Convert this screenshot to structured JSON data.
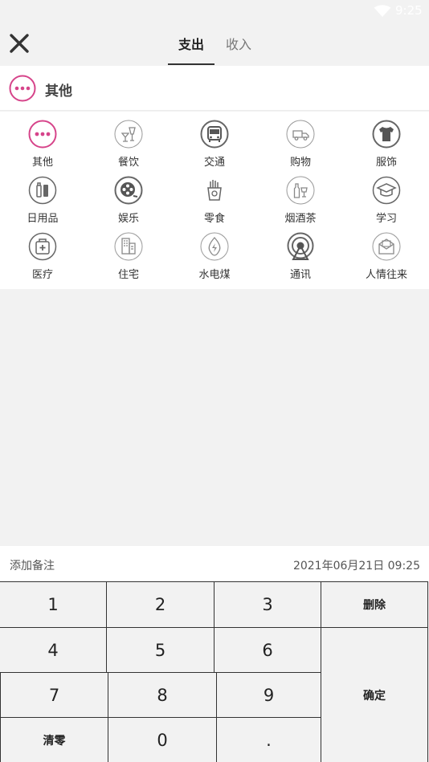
{
  "status_bar": {
    "time": "9:25"
  },
  "tabs": [
    {
      "label": "支出",
      "active": true
    },
    {
      "label": "收入",
      "active": false
    }
  ],
  "selected_category": {
    "label": "其他",
    "icon": "more-dots-icon",
    "accent_color": "#d6448a"
  },
  "categories": [
    {
      "label": "其他",
      "icon": "more-dots-icon"
    },
    {
      "label": "餐饮",
      "icon": "dining-icon"
    },
    {
      "label": "交通",
      "icon": "bus-icon"
    },
    {
      "label": "购物",
      "icon": "truck-icon"
    },
    {
      "label": "服饰",
      "icon": "tshirt-icon"
    },
    {
      "label": "日用品",
      "icon": "toiletries-icon"
    },
    {
      "label": "娱乐",
      "icon": "film-reel-icon"
    },
    {
      "label": "零食",
      "icon": "snack-icon"
    },
    {
      "label": "烟酒茶",
      "icon": "bottle-cup-icon"
    },
    {
      "label": "学习",
      "icon": "graduation-cap-icon"
    },
    {
      "label": "医疗",
      "icon": "medical-kit-icon"
    },
    {
      "label": "住宅",
      "icon": "building-icon"
    },
    {
      "label": "水电煤",
      "icon": "utility-bolt-icon"
    },
    {
      "label": "通讯",
      "icon": "signal-tower-icon"
    },
    {
      "label": "人情往来",
      "icon": "envelope-icon"
    }
  ],
  "note": {
    "placeholder": "添加备注",
    "date": "2021年06月21日 09:25"
  },
  "keypad": {
    "k1": "1",
    "k2": "2",
    "k3": "3",
    "delete": "删除",
    "k4": "4",
    "k5": "5",
    "k6": "6",
    "k7": "7",
    "k8": "8",
    "k9": "9",
    "confirm": "确定",
    "clear": "清零",
    "k0": "0",
    "dot": "."
  }
}
